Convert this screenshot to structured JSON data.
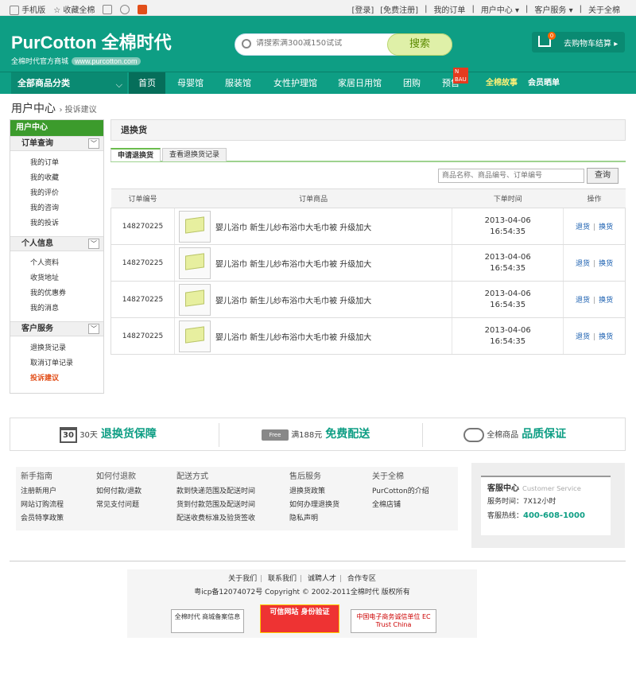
{
  "topbar": {
    "mobile": "手机版",
    "favorite": "收藏全棉",
    "login": "[登录]",
    "register": "[免费注册]",
    "my_orders": "我的订单",
    "user_center": "用户中心",
    "customer_service": "客户服务",
    "about": "关于全棉"
  },
  "header": {
    "logo": "PurCotton 全棉时代",
    "tagline": "全棉时代官方商城",
    "url": "www.purcotton.com",
    "search_placeholder": "请搜索满300减150试试",
    "search_button": "搜索",
    "cart_count": "0",
    "cart_label": "去购物车结算"
  },
  "nav": {
    "all_categories": "全部商品分类",
    "items": [
      "首页",
      "母婴馆",
      "服装馆",
      "女性护理馆",
      "家居日用馆",
      "团购",
      "预售",
      "全棉故事",
      "会员晒单"
    ],
    "presale_badge": "N BAU"
  },
  "breadcrumb": {
    "title": "用户中心",
    "current": "投诉建议"
  },
  "sidebar": {
    "header": "用户中心",
    "groups": [
      {
        "title": "订单查询",
        "items": [
          "我的订单",
          "我的收藏",
          "我的评价",
          "我的咨询",
          "我的投诉"
        ]
      },
      {
        "title": "个人信息",
        "items": [
          "个人资料",
          "收货地址",
          "我的优惠券",
          "我的消息"
        ]
      },
      {
        "title": "客户服务",
        "items": [
          "退换货记录",
          "取消订单记录",
          "投诉建议"
        ]
      }
    ]
  },
  "main": {
    "title": "退换货",
    "tabs": [
      "申请退换货",
      "查看退换货记录"
    ],
    "filter_placeholder": "商品名称、商品编号、订单编号",
    "query_button": "查询",
    "columns": [
      "订单编号",
      "订单商品",
      "下单时间",
      "操作"
    ],
    "rows": [
      {
        "id": "148270225",
        "product": "婴儿浴巾 新生儿纱布浴巾大毛巾被 升级加大",
        "date": "2013-04-06",
        "time": "16:54:35",
        "return": "退货",
        "exchange": "换货"
      },
      {
        "id": "148270225",
        "product": "婴儿浴巾 新生儿纱布浴巾大毛巾被 升级加大",
        "date": "2013-04-06",
        "time": "16:54:35",
        "return": "退货",
        "exchange": "换货"
      },
      {
        "id": "148270225",
        "product": "婴儿浴巾 新生儿纱布浴巾大毛巾被 升级加大",
        "date": "2013-04-06",
        "time": "16:54:35",
        "return": "退货",
        "exchange": "换货"
      },
      {
        "id": "148270225",
        "product": "婴儿浴巾 新生儿纱布浴巾大毛巾被 升级加大",
        "date": "2013-04-06",
        "time": "16:54:35",
        "return": "退货",
        "exchange": "换货"
      }
    ]
  },
  "guarantee": [
    {
      "icon_text": "30",
      "pre": "30天",
      "strong": "退换货保障"
    },
    {
      "icon_text": "Free",
      "pre": "满188元",
      "strong": "免费配送"
    },
    {
      "icon_text": "",
      "pre": "全棉商品",
      "strong": "品质保证"
    }
  ],
  "footer": {
    "columns": [
      {
        "title": "新手指南",
        "items": [
          "注册新用户",
          "网站订购流程",
          "会员特享政策"
        ]
      },
      {
        "title": "如何付退款",
        "items": [
          "如何付款/退款",
          "常见支付问题"
        ]
      },
      {
        "title": "配送方式",
        "items": [
          "款到快递范围及配送时间",
          "货到付款范围及配送时间",
          "配送收费标准及验货签收"
        ]
      },
      {
        "title": "售后服务",
        "items": [
          "退换货政策",
          "如何办理退换货",
          "隐私声明"
        ]
      },
      {
        "title": "关于全棉",
        "items": [
          "PurCotton的介绍",
          "全棉店铺"
        ]
      }
    ],
    "service": {
      "title": "客服中心",
      "title_en": "Customer Service",
      "hours": "服务时间：7X12小时",
      "hotline_label": "客服热线：",
      "hotline": "400-608-1000"
    },
    "links": [
      "关于我们",
      "联系我们",
      "诚聘人才",
      "合作专区"
    ],
    "copyright": "粤icp备12074072号 Copyright © 2002-2011全棉时代 版权所有",
    "certs": [
      "全棉时代 商城备案信息",
      "可信网站 身份验证",
      "中国电子商务诚信单位 EC Trust China"
    ]
  }
}
